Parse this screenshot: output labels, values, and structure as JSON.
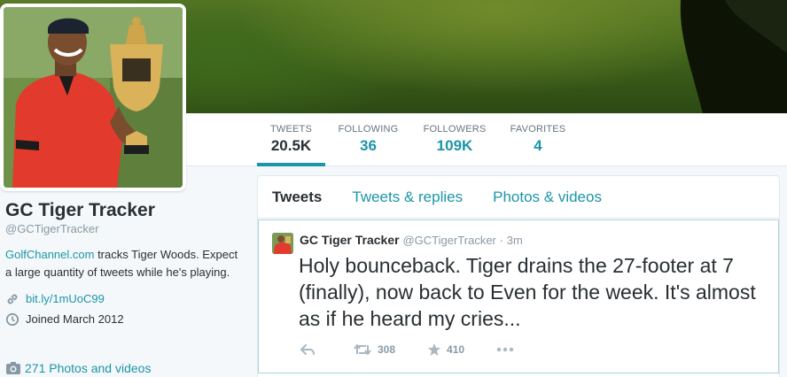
{
  "profile": {
    "name": "GC Tiger Tracker",
    "handle": "@GCTigerTracker",
    "bio_link": "GolfChannel.com",
    "bio_rest": " tracks Tiger Woods. Expect a large quantity of tweets while he's playing.",
    "url": "bit.ly/1mUoC99",
    "joined": "Joined March 2012",
    "photos": "271 Photos and videos"
  },
  "nav": {
    "tweets": {
      "label": "TWEETS",
      "value": "20.5K"
    },
    "following": {
      "label": "FOLLOWING",
      "value": "36"
    },
    "followers": {
      "label": "FOLLOWERS",
      "value": "109K"
    },
    "favorites": {
      "label": "FAVORITES",
      "value": "4"
    }
  },
  "tabs": [
    "Tweets",
    "Tweets & replies",
    "Photos & videos"
  ],
  "tweet": {
    "name": "GC Tiger Tracker",
    "handle": "@GCTigerTracker",
    "time": "· 3m",
    "text": "Holy bounceback. Tiger drains the 27-footer at 7 (finally), now back to Even for the week. It's almost as if he heard my cries...",
    "retweets": "308",
    "favorites": "410"
  },
  "colors": {
    "accent": "#1b95a8",
    "text": "#292f33",
    "muted": "#8899a6"
  }
}
